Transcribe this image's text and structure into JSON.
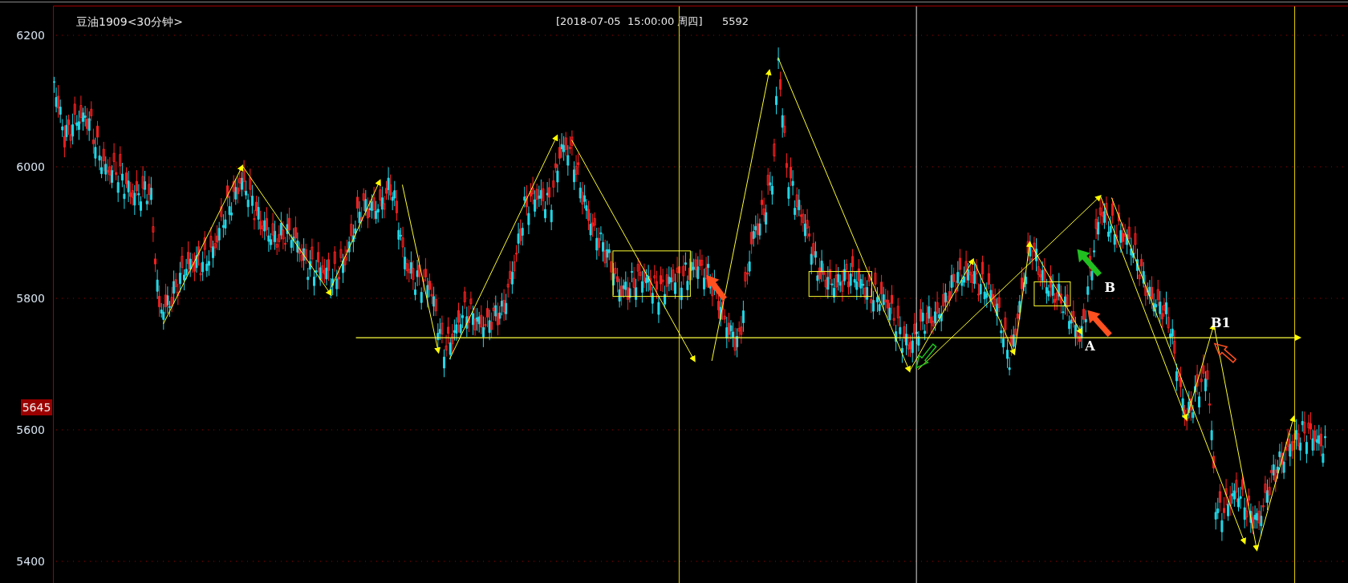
{
  "header": {
    "title": "豆油1909<30分钟>",
    "cursor_info": "[2018-07-05  15:00:00 周四]",
    "cursor_value": "5592"
  },
  "price_axis": {
    "ticks": [
      "6200",
      "6000",
      "5800",
      "5600",
      "5400"
    ],
    "current_price": "5645"
  },
  "annotations": [
    {
      "label": "A"
    },
    {
      "label": "B"
    },
    {
      "label": "B1"
    }
  ]
}
